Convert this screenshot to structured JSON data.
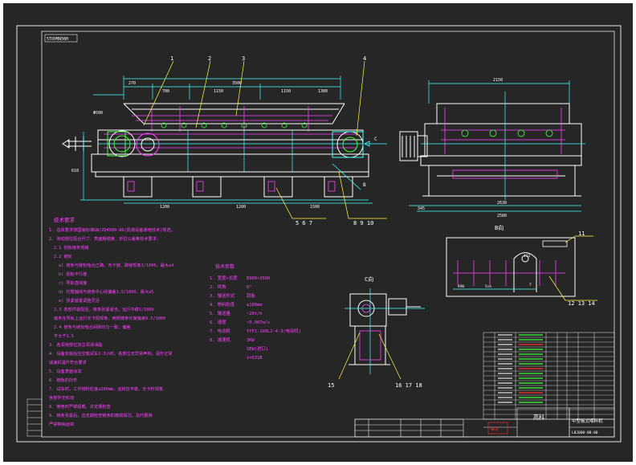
{
  "drawing": {
    "top_tag": "5ТОУМЯЭ8Н",
    "colors": {
      "sheet_bg": "#262626",
      "frame": "#e6e6e6",
      "main_line": "#ffffff",
      "magenta": "#ff40ff",
      "cyan": "#40ffff",
      "yellow": "#ffff40",
      "green": "#40ff40",
      "red": "#ff3030",
      "blue": "#5a7dff"
    },
    "callouts": {
      "c1": "1",
      "c2": "2",
      "c3": "3",
      "c4": "4",
      "c567": "5 6 7",
      "c8910": "8 9 10",
      "c11": "11",
      "c121314": "12 13 14",
      "c15": "15",
      "c161718": "16 17 18"
    },
    "view_labels": {
      "b_view": "B向",
      "c_view": "C向",
      "c_arrow": "C",
      "b_arrow": "B"
    },
    "front_dims": {
      "d270": "270",
      "d700": "700",
      "d1150a": "1150",
      "d1150b": "1150",
      "d1380": "1380",
      "d3500": "3500",
      "d500": "Φ500",
      "d610": "610",
      "d1200": "1200",
      "d1200b": "1200",
      "d1500": "1500"
    },
    "side_dims": {
      "d2150": "2150",
      "d2580": "2580",
      "d2630": "2630",
      "d345": "345"
    },
    "bview_dims": {
      "d490": "490",
      "d5nx": "5×n",
      "d113": "113",
      "d7": "7"
    },
    "tech_title": "技术要求",
    "tech_lines": [
      "1. 总体要求按国家标准GB/ZQ4000-86(机械设备通用技术)规范。",
      "2. 滑动部位配合尺寸、表面粗糙度、形位公差等技术要求：",
      "2.1  刮板链条规格",
      "2.2  链轮",
      "a) 链条与链轮啮合正确，无卡链、跳链现象1/1000，最大≤4",
      "b) 刮板平行度",
      "c) 导轨直线度",
      "d) 托辊轴线与链条中心线偏差1.5/1000，最大≤5",
      "e) 张紧装置调整灵活",
      "2.3  各部件装配后，链条张紧适当，运行平稳1/1000",
      "      链条在导轨上运行无卡阻现象，两侧链条长度偏差0.5/1000",
      "2.4  链条与链轮啮合间隙均匀一致，偏差",
      "      不大于1.5",
      "3. 各润滑部位加注润滑油脂",
      "4. 设备安装后应空载试车2-3小时，各部位无异常声响，温升正常",
      "   减速机温升符合要求",
      "5. 设备表面涂漆",
      "6. 链板的外形",
      "7. 试车时，工作物料粒度≤200mm，运转应平稳，无卡料现象",
      "   各部件无松动",
      "8. 使用时严禁超载，并定期检查",
      "9. 链条张紧后，应定期检查链条的磨损情况，及时更换",
      "   严禁带病运转"
    ],
    "param_title": "技术参数",
    "params": [
      {
        "k": "1.  宽度×长度",
        "v": "B900×3500"
      },
      {
        "k": "2.  倾角",
        "v": "0°"
      },
      {
        "k": "3.  输送形式",
        "v": "刮板"
      },
      {
        "k": "4.  物料粒度",
        "v": "≤100mm"
      },
      {
        "k": "5.  输送量",
        "v": "~20t/h"
      },
      {
        "k": "6.  速度",
        "v": "~0.007m/s"
      },
      {
        "k": "7.  电动机",
        "v": "YYF2-100L2-4-3(电动机)"
      },
      {
        "k": "",
        "v": "3KW"
      },
      {
        "k": "8.  减速机",
        "v": "SEW(进口)"
      },
      {
        "k": "",
        "v": "i=531B"
      }
    ],
    "title_block": {
      "company": "高科",
      "drawing_name": "中型板式喂料机",
      "drawing_no": "LBJ000-00-00"
    },
    "stamp": "审定"
  }
}
